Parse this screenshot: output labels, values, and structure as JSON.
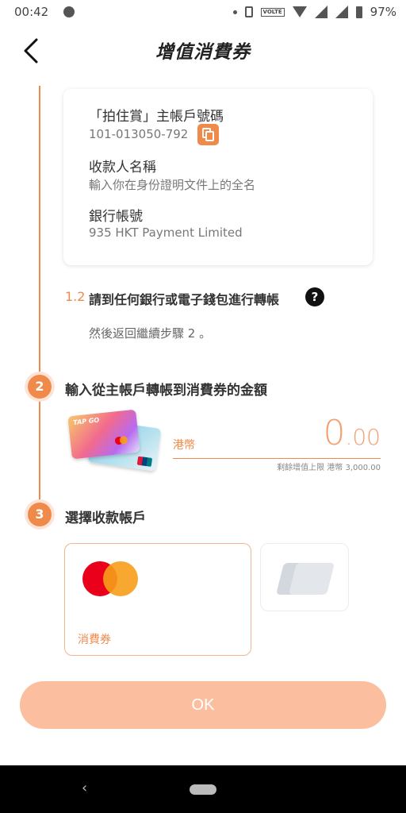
{
  "status_bar": {
    "time": "00:42",
    "volte": "VOLTE",
    "battery": "97%"
  },
  "header": {
    "title": "增值消費券"
  },
  "account_card": {
    "main_account_label": "「拍住賞」主帳戶號碼",
    "main_account_value": "101-013050-792",
    "payee_label": "收款人名稱",
    "payee_value": "輸入你在身份證明文件上的全名",
    "bank_account_label": "銀行帳號",
    "bank_account_value": "935 HKT Payment Limited"
  },
  "step_1_2": {
    "number": "1.2",
    "title": "請到任何銀行或電子錢包進行轉帳",
    "help": "?",
    "hint": "然後返回繼續步驟 2 。"
  },
  "step_2": {
    "number": "2",
    "title": "輸入從主帳戶轉帳到消費券的金額",
    "card_logo": "TAP GO",
    "currency": "港幣",
    "amount_int": "0",
    "amount_dec": ".00",
    "limit": "剩餘增值上限 港幣 3,000.00"
  },
  "step_3": {
    "number": "3",
    "title": "選擇收款帳戶",
    "account_label": "消費券"
  },
  "ok_button": "OK",
  "colors": {
    "accent": "#f08a4b",
    "ok_button": "#fbbfa0"
  }
}
